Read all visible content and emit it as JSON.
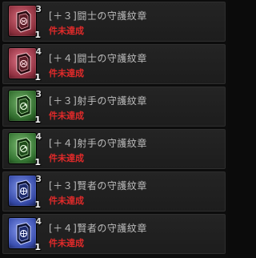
{
  "items": [
    {
      "name": "[＋３]闘士の守護紋章",
      "status": "件未達成",
      "tier": "3",
      "count": "1",
      "icon": "red-crest-icon",
      "color": "#a8404f"
    },
    {
      "name": "[＋４]闘士の守護紋章",
      "status": "件未達成",
      "tier": "4",
      "count": "1",
      "icon": "red-crest-icon",
      "color": "#b04454"
    },
    {
      "name": "[＋３]射手の守護紋章",
      "status": "件未達成",
      "tier": "3",
      "count": "1",
      "icon": "green-crest-icon",
      "color": "#3f7a3a"
    },
    {
      "name": "[＋４]射手の守護紋章",
      "status": "件未達成",
      "tier": "4",
      "count": "1",
      "icon": "green-crest-icon",
      "color": "#468342"
    },
    {
      "name": "[＋３]賢者の守護紋章",
      "status": "件未達成",
      "tier": "3",
      "count": "1",
      "icon": "blue-crest-icon",
      "color": "#3a53b0"
    },
    {
      "name": "[＋４]賢者の守護紋章",
      "status": "件未達成",
      "tier": "4",
      "count": "1",
      "icon": "blue-crest-icon",
      "color": "#4059bb"
    }
  ]
}
